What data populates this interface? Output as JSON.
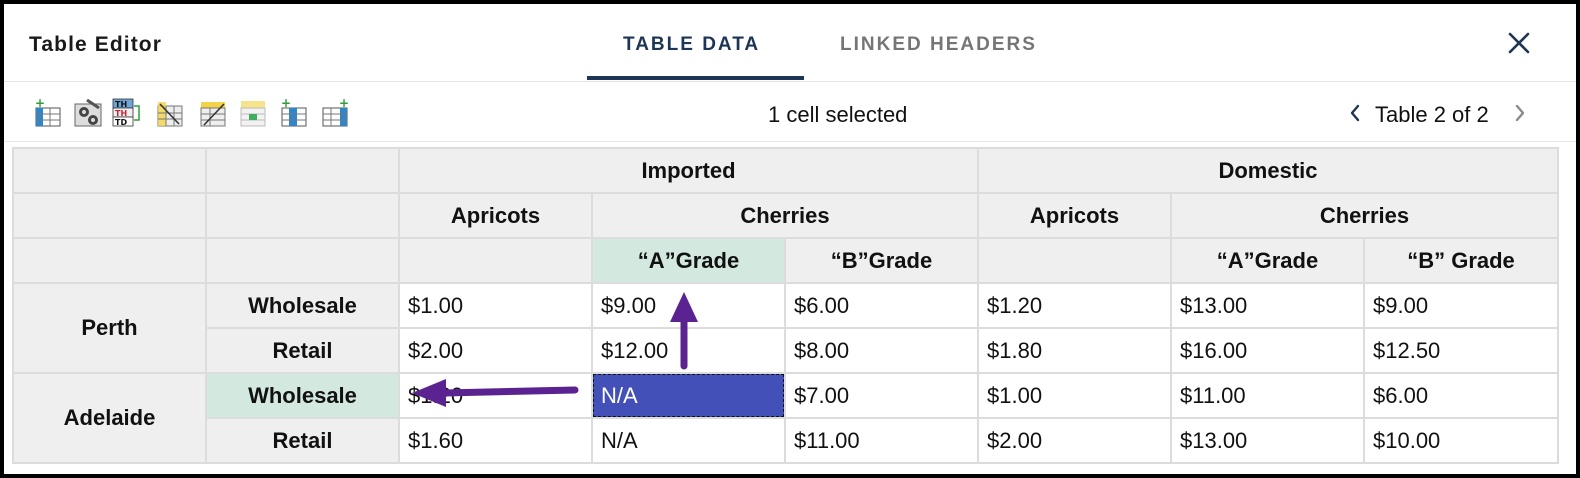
{
  "header": {
    "title": "Table Editor",
    "tabs": [
      {
        "label": "TABLE DATA",
        "active": true
      },
      {
        "label": "LINKED HEADERS",
        "active": false
      }
    ],
    "close_icon": "close-icon"
  },
  "toolbar": {
    "icons": [
      "insert-row-icon",
      "cell-properties-icon",
      "header-cell-type-icon",
      "column-header-link-icon",
      "row-header-link-icon",
      "merge-cells-icon",
      "insert-column-icon",
      "delete-column-icon"
    ],
    "status": "1 cell selected",
    "pager": "Table 2 of 2"
  },
  "table": {
    "row1": {
      "imported": "Imported",
      "domestic": "Domestic"
    },
    "row2": {
      "imp_apricots": "Apricots",
      "imp_cherries": "Cherries",
      "dom_apricots": "Apricots",
      "dom_cherries": "Cherries"
    },
    "row3": {
      "imp_a_grade": "“A”Grade",
      "imp_b_grade": "“B”Grade",
      "dom_a_grade": "“A”Grade",
      "dom_b_grade": "“B” Grade"
    },
    "perth": {
      "label": "Perth",
      "wholesale": {
        "label": "Wholesale",
        "values": [
          "$1.00",
          "$9.00",
          "$6.00",
          "$1.20",
          "$13.00",
          "$9.00"
        ]
      },
      "retail": {
        "label": "Retail",
        "values": [
          "$2.00",
          "$12.00",
          "$8.00",
          "$1.80",
          "$16.00",
          "$12.50"
        ]
      }
    },
    "adelaide": {
      "label": "Adelaide",
      "wholesale": {
        "label": "Wholesale",
        "values": [
          "$1.20",
          "N/A",
          "$7.00",
          "$1.00",
          "$11.00",
          "$6.00"
        ]
      },
      "retail": {
        "label": "Retail",
        "values": [
          "$1.60",
          "N/A",
          "$11.00",
          "$2.00",
          "$13.00",
          "$10.00"
        ]
      }
    }
  },
  "colors": {
    "accent": "#1d3556",
    "selected_cell": "#4250b8",
    "header_highlight": "#d3e8df",
    "annotation_arrow": "#5b2391"
  }
}
